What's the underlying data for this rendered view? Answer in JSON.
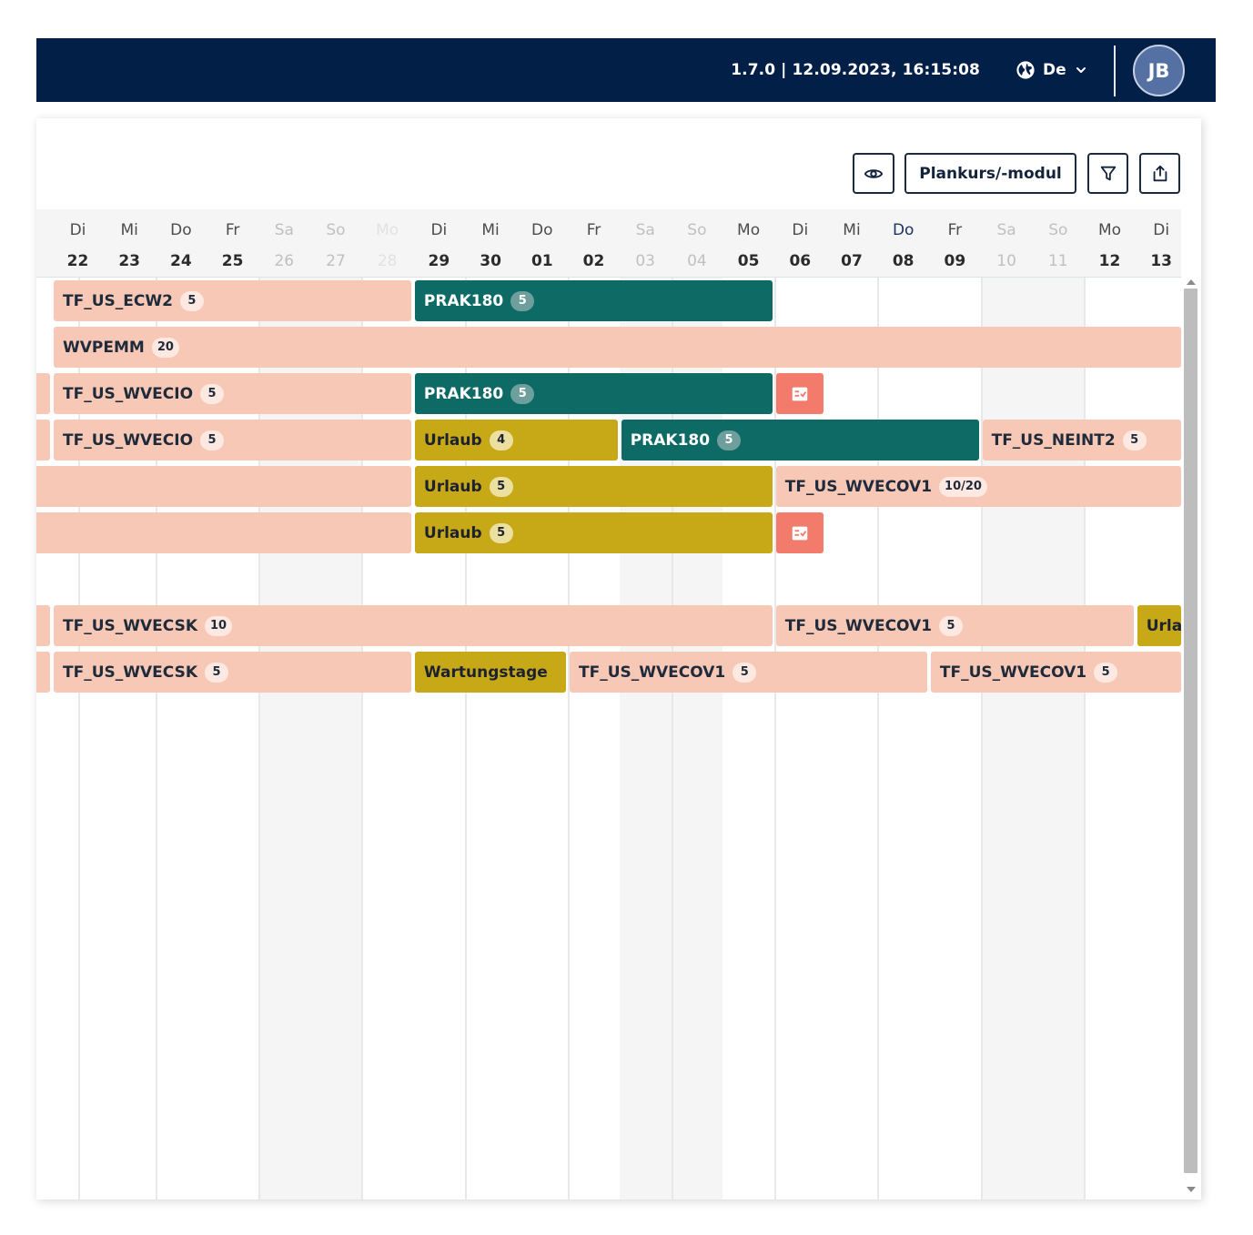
{
  "header": {
    "version_text": "1.7.0 | 12.09.2023, 16:15:08",
    "language": "De",
    "language_icon": "globe-icon",
    "avatar_initials": "JB",
    "background_color": "#021f48"
  },
  "toolbar": {
    "view_icon": "eye-icon",
    "plan_button_label": "Plankurs/-modul",
    "filter_icon": "filter-icon",
    "export_icon": "share-export-icon"
  },
  "dates": [
    {
      "wd": "Di",
      "day": "22",
      "type": "normal"
    },
    {
      "wd": "Mi",
      "day": "23",
      "type": "normal"
    },
    {
      "wd": "Do",
      "day": "24",
      "type": "normal"
    },
    {
      "wd": "Fr",
      "day": "25",
      "type": "normal"
    },
    {
      "wd": "Sa",
      "day": "26",
      "type": "weekend"
    },
    {
      "wd": "So",
      "day": "27",
      "type": "weekend"
    },
    {
      "wd": "Mo",
      "day": "28",
      "type": "holiday"
    },
    {
      "wd": "Di",
      "day": "29",
      "type": "normal"
    },
    {
      "wd": "Mi",
      "day": "30",
      "type": "normal"
    },
    {
      "wd": "Do",
      "day": "01",
      "type": "normal"
    },
    {
      "wd": "Fr",
      "day": "02",
      "type": "normal"
    },
    {
      "wd": "Sa",
      "day": "03",
      "type": "weekend"
    },
    {
      "wd": "So",
      "day": "04",
      "type": "weekend"
    },
    {
      "wd": "Mo",
      "day": "05",
      "type": "normal"
    },
    {
      "wd": "Di",
      "day": "06",
      "type": "normal"
    },
    {
      "wd": "Mi",
      "day": "07",
      "type": "normal"
    },
    {
      "wd": "Do",
      "day": "08",
      "type": "current"
    },
    {
      "wd": "Fr",
      "day": "09",
      "type": "normal"
    },
    {
      "wd": "Sa",
      "day": "10",
      "type": "weekend"
    },
    {
      "wd": "So",
      "day": "11",
      "type": "weekend"
    },
    {
      "wd": "Mo",
      "day": "12",
      "type": "normal"
    },
    {
      "wd": "Di",
      "day": "13",
      "type": "normal"
    }
  ],
  "rows": [
    {
      "bars": [
        {
          "label": "TF_US_ECW2",
          "badge": "5",
          "kind": "peach",
          "start": 0,
          "end": 7
        },
        {
          "label": "PRAK180",
          "badge": "5",
          "kind": "teal",
          "start": 7,
          "end": 14
        }
      ]
    },
    {
      "bars": [
        {
          "label": "WVPEMM",
          "badge": "20",
          "kind": "peach",
          "start": 0,
          "end": 22
        }
      ]
    },
    {
      "bars": [
        {
          "label": "",
          "badge": "",
          "kind": "peach",
          "start": -1,
          "end": 0
        },
        {
          "label": "TF_US_WVECIO",
          "badge": "5",
          "kind": "peach",
          "start": 0,
          "end": 7
        },
        {
          "label": "PRAK180",
          "badge": "5",
          "kind": "teal",
          "start": 7,
          "end": 14
        },
        {
          "label": "",
          "badge": "",
          "kind": "coral",
          "icon": "task-checklist-icon",
          "start": 14,
          "end": 15
        }
      ]
    },
    {
      "bars": [
        {
          "label": "",
          "badge": "",
          "kind": "peach",
          "start": -1,
          "end": 0
        },
        {
          "label": "TF_US_WVECIO",
          "badge": "5",
          "kind": "peach",
          "start": 0,
          "end": 7
        },
        {
          "label": "Urlaub",
          "badge": "4",
          "kind": "gold",
          "start": 7,
          "end": 11
        },
        {
          "label": "PRAK180",
          "badge": "5",
          "kind": "teal",
          "start": 11,
          "end": 18
        },
        {
          "label": "TF_US_NEINT2",
          "badge": "5",
          "kind": "peach",
          "start": 18,
          "end": 22
        }
      ]
    },
    {
      "bars": [
        {
          "label": "",
          "badge": "",
          "kind": "peach",
          "start": -1,
          "end": 7
        },
        {
          "label": "Urlaub",
          "badge": "5",
          "kind": "gold",
          "start": 7,
          "end": 14
        },
        {
          "label": "TF_US_WVECOV1",
          "badge": "10/20",
          "kind": "peach",
          "start": 14,
          "end": 22
        }
      ]
    },
    {
      "bars": [
        {
          "label": "",
          "badge": "",
          "kind": "peach",
          "start": -1,
          "end": 7
        },
        {
          "label": "Urlaub",
          "badge": "5",
          "kind": "gold",
          "start": 7,
          "end": 14
        },
        {
          "label": "",
          "badge": "",
          "kind": "coral",
          "icon": "task-checklist-icon",
          "start": 14,
          "end": 15
        }
      ]
    },
    {
      "bars": []
    },
    {
      "bars": [
        {
          "label": "",
          "badge": "",
          "kind": "peach",
          "start": -1,
          "end": 0
        },
        {
          "label": "TF_US_WVECSK",
          "badge": "10",
          "kind": "peach",
          "start": 0,
          "end": 14
        },
        {
          "label": "TF_US_WVECOV1",
          "badge": "5",
          "kind": "peach",
          "start": 14,
          "end": 21
        },
        {
          "label": "Urlaub",
          "badge": "",
          "kind": "gold",
          "start": 21,
          "end": 22
        }
      ]
    },
    {
      "bars": [
        {
          "label": "",
          "badge": "",
          "kind": "peach",
          "start": -1,
          "end": 0
        },
        {
          "label": "TF_US_WVECSK",
          "badge": "5",
          "kind": "peach",
          "start": 0,
          "end": 7
        },
        {
          "label": "Wartungstage",
          "badge": "",
          "kind": "gold",
          "start": 7,
          "end": 10
        },
        {
          "label": "TF_US_WVECOV1",
          "badge": "5",
          "kind": "peach",
          "start": 10,
          "end": 17
        },
        {
          "label": "TF_US_WVECOV1",
          "badge": "5",
          "kind": "peach",
          "start": 17,
          "end": 22
        }
      ]
    }
  ]
}
